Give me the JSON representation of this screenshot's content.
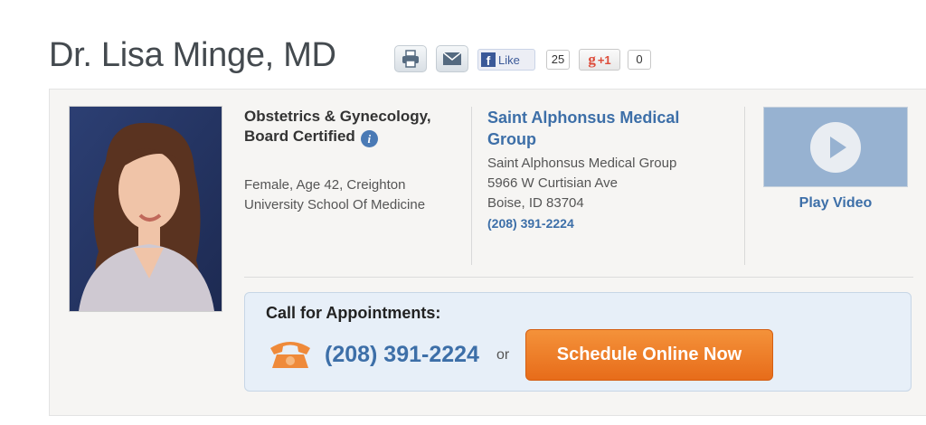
{
  "profile": {
    "title": "Dr. Lisa Minge, MD",
    "specialty": "Obstetrics & Gynecology, Board Certified",
    "details": "Female, Age 42, Creighton University School Of Medicine"
  },
  "share": {
    "like_label": "Like",
    "like_count": "25",
    "plus_label": "+1",
    "plus_count": "0"
  },
  "practice": {
    "name": "Saint Alphonsus Medical Group",
    "address_name": "Saint Alphonsus Medical Group",
    "street": "5966 W Curtisian Ave",
    "city": "Boise, ID 83704",
    "phone": "(208) 391-2224"
  },
  "video": {
    "label": "Play Video"
  },
  "appointments": {
    "heading": "Call for Appointments:",
    "phone": "(208) 391-2224",
    "or_text": "or",
    "schedule_label": "Schedule Online Now"
  },
  "colors": {
    "link_blue": "#3d6fa8",
    "schedule_orange": "#ee7d26",
    "card_bg": "#f6f5f3",
    "appointment_bg": "#e7eff8"
  }
}
